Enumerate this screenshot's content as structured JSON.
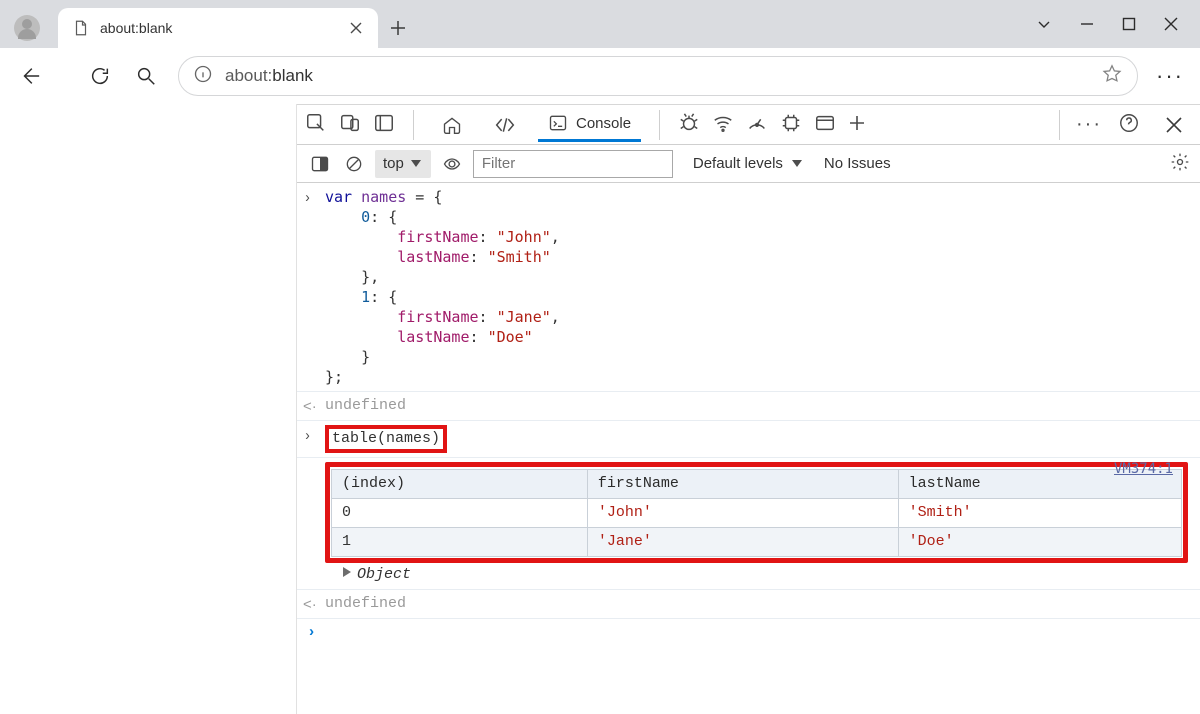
{
  "browser": {
    "tab_title": "about:blank",
    "address_prefix": "about:",
    "address_rest": "blank"
  },
  "devtools": {
    "tabs": {
      "console": "Console"
    },
    "console_toolbar": {
      "context": "top",
      "filter_placeholder": "Filter",
      "levels": "Default levels",
      "issues": "No Issues"
    }
  },
  "console": {
    "entry1_lines": [
      "var names = {",
      "    0: {",
      "        firstName: \"John\",",
      "        lastName: \"Smith\"",
      "    },",
      "    1: {",
      "        firstName: \"Jane\",",
      "        lastName: \"Doe\"",
      "    }",
      "};"
    ],
    "undefined": "undefined",
    "entry2": "table(names)",
    "vm_ref": "VM374:1",
    "object_line": "Object",
    "table": {
      "headers": [
        "(index)",
        "firstName",
        "lastName"
      ],
      "rows": [
        {
          "index": "0",
          "firstName": "'John'",
          "lastName": "'Smith'"
        },
        {
          "index": "1",
          "firstName": "'Jane'",
          "lastName": "'Doe'"
        }
      ]
    }
  }
}
